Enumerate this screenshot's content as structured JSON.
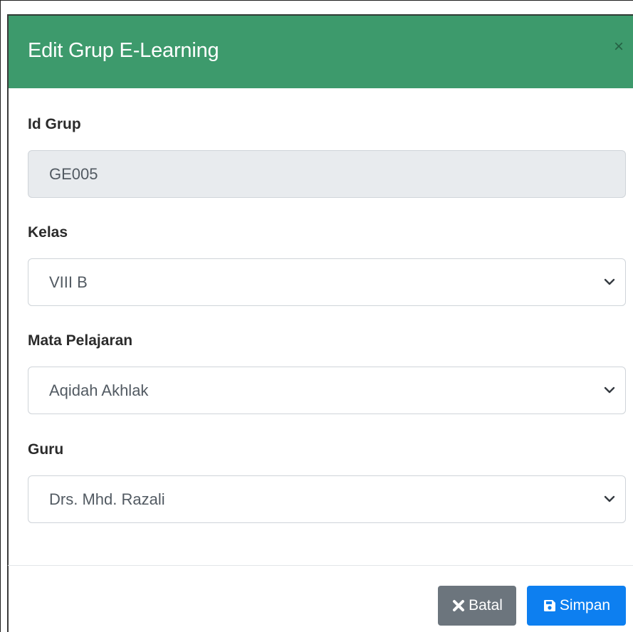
{
  "modal": {
    "title": "Edit Grup E-Learning",
    "close_symbol": "×"
  },
  "form": {
    "id_grup": {
      "label": "Id Grup",
      "value": "GE005"
    },
    "kelas": {
      "label": "Kelas",
      "selected": "VIII B"
    },
    "mata_pelajaran": {
      "label": "Mata Pelajaran",
      "selected": "Aqidah Akhlak"
    },
    "guru": {
      "label": "Guru",
      "selected": "Drs. Mhd. Razali"
    }
  },
  "footer": {
    "cancel_label": "Batal",
    "save_label": "Simpan"
  },
  "icons": {
    "close": "close-icon",
    "cancel": "times-icon",
    "save": "floppy-disk-icon",
    "dropdown": "chevron-down-icon"
  },
  "colors": {
    "header": "#3d9a6c",
    "cancel_button": "#6c757d",
    "save_button": "#0d7ff0",
    "readonly_field": "#e8ebee"
  }
}
